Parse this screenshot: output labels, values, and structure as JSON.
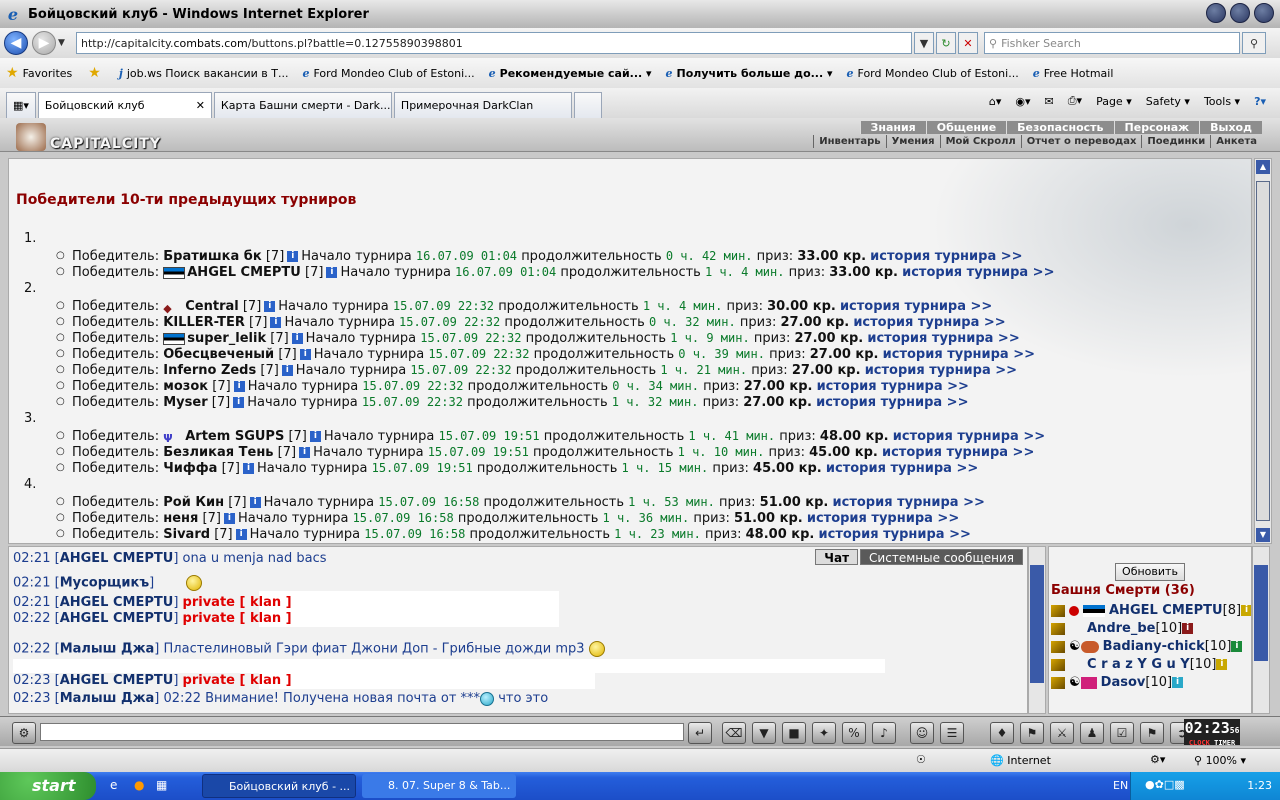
{
  "window": {
    "title": "Бойцовский клуб - Windows Internet Explorer"
  },
  "address": {
    "url_prefix": "http://capitalcity.",
    "url_host": "combats.com",
    "url_suffix": "/buttons.pl?battle=0.12755890398801",
    "search_placeholder": "Fishker Search"
  },
  "favorites": {
    "label": "Favorites",
    "links": [
      "job.ws Поиск вакансии в Т...",
      "Ford Mondeo Club of Estoni...",
      "Рекомендуемые сай...",
      "Получить больше до...",
      "Ford Mondeo Club of Estoni...",
      "Free Hotmail"
    ]
  },
  "tabs": [
    "Бойцовский клуб",
    "Карта Башни смерти - Dark...",
    "Примерочная DarkClan"
  ],
  "tab_tools": {
    "page": "Page",
    "safety": "Safety",
    "tools": "Tools"
  },
  "game": {
    "logo": "CAPITALCITY",
    "top_menu": [
      "Знания",
      "Общение",
      "Безопасность",
      "Персонаж",
      "Выход"
    ],
    "sub_menu": [
      "Инвентарь",
      "Умения",
      "Мой Скролл",
      "Отчет о переводах",
      "Поединки",
      "Анкета"
    ],
    "heading": "Победители 10-ти предыдущих турниров",
    "lbl_winner": "Победитель:",
    "lbl_start": "Начало турнира",
    "lbl_dur": "продолжительность",
    "lbl_prize": "приз:",
    "lbl_hist": "история турнира >>",
    "tournaments": [
      {
        "n": "1.",
        "winners": [
          {
            "name": "Братишка бк",
            "lvl": "[7]",
            "start": "16.07.09 01:04",
            "dur": "0 ч. 42 мин.",
            "prize": "33.00 кр."
          },
          {
            "name": "AHGEL CMEPTU",
            "lvl": "[7]",
            "start": "16.07.09 01:04",
            "dur": "1 ч. 4 мин.",
            "prize": "33.00 кр."
          }
        ]
      },
      {
        "n": "2.",
        "winners": [
          {
            "name": "Central",
            "lvl": "[7]",
            "start": "15.07.09 22:32",
            "dur": "1 ч. 4 мин.",
            "prize": "30.00 кр."
          },
          {
            "name": "KILLER-TER",
            "lvl": "[7]",
            "start": "15.07.09 22:32",
            "dur": "0 ч. 32 мин.",
            "prize": "27.00 кр."
          },
          {
            "name": "super_lelik",
            "lvl": "[7]",
            "start": "15.07.09 22:32",
            "dur": "1 ч. 9 мин.",
            "prize": "27.00 кр."
          },
          {
            "name": "Обесцвеченый",
            "lvl": "[7]",
            "start": "15.07.09 22:32",
            "dur": "0 ч. 39 мин.",
            "prize": "27.00 кр."
          },
          {
            "name": "Inferno Zeds",
            "lvl": "[7]",
            "start": "15.07.09 22:32",
            "dur": "1 ч. 21 мин.",
            "prize": "27.00 кр."
          },
          {
            "name": "мозок",
            "lvl": "[7]",
            "start": "15.07.09 22:32",
            "dur": "0 ч. 34 мин.",
            "prize": "27.00 кр."
          },
          {
            "name": "Myser",
            "lvl": "[7]",
            "start": "15.07.09 22:32",
            "dur": "1 ч. 32 мин.",
            "prize": "27.00 кр."
          }
        ]
      },
      {
        "n": "3.",
        "winners": [
          {
            "name": "Artem SGUPS",
            "lvl": "[7]",
            "start": "15.07.09 19:51",
            "dur": "1 ч. 41 мин.",
            "prize": "48.00 кр."
          },
          {
            "name": "Безликая Тень",
            "lvl": "[7]",
            "start": "15.07.09 19:51",
            "dur": "1 ч. 10 мин.",
            "prize": "45.00 кр."
          },
          {
            "name": "Чиффа",
            "lvl": "[7]",
            "start": "15.07.09 19:51",
            "dur": "1 ч. 15 мин.",
            "prize": "45.00 кр."
          }
        ]
      },
      {
        "n": "4.",
        "winners": [
          {
            "name": "Рой Кин",
            "lvl": "[7]",
            "start": "15.07.09 16:58",
            "dur": "1 ч. 53 мин.",
            "prize": "51.00 кр."
          },
          {
            "name": "неня",
            "lvl": "[7]",
            "start": "15.07.09 16:58",
            "dur": "1 ч. 36 мин.",
            "prize": "51.00 кр."
          },
          {
            "name": "Sivard",
            "lvl": "[7]",
            "start": "15.07.09 16:58",
            "dur": "1 ч. 23 мин.",
            "prize": "48.00 кр."
          }
        ]
      }
    ]
  },
  "chat": {
    "tabs": [
      "Чат",
      "Системные сообщения"
    ],
    "lines": [
      {
        "time": "02:21",
        "who": "AHGEL CMEPTU",
        "text": "ona u menja nad bacs",
        "priv": ""
      },
      {
        "time": "02:21",
        "who": "Мусорщикъ",
        "text": "",
        "priv": ""
      },
      {
        "time": "02:21",
        "who": "AHGEL CMEPTU",
        "text": "",
        "priv": "private [ klan ]"
      },
      {
        "time": "02:22",
        "who": "AHGEL CMEPTU",
        "text": "",
        "priv": "private [ klan ]"
      },
      {
        "time": "02:22",
        "who": "Малыш Джа",
        "text": "Пластелиновый Гэри фиат Джони Доп - Грибные дожди mp3",
        "priv": ""
      },
      {
        "time": "02:23",
        "who": "AHGEL CMEPTU",
        "text": "",
        "priv": "private [ klan ]"
      },
      {
        "time": "02:23",
        "who": "Малыш Джа",
        "text": "02:22 Внимание! Получена новая почта от ***",
        "priv": "",
        "tail": "что это"
      }
    ]
  },
  "online": {
    "refresh": "Обновить",
    "room": "Башня Смерти (36)",
    "users": [
      {
        "name": "AHGEL CMEPTU",
        "lvl": "[8]"
      },
      {
        "name": "Andre_be",
        "lvl": "[10]"
      },
      {
        "name": "Badiany-chick",
        "lvl": "[10]"
      },
      {
        "name": "C r a z Y G u Y",
        "lvl": "[10]"
      },
      {
        "name": "Dasov",
        "lvl": "[10]"
      }
    ]
  },
  "clock": {
    "time": "02:23",
    "sec": "56",
    "lbl_clock": "CLOCK",
    "lbl_timer": "TIMER"
  },
  "status": {
    "zone": "Internet",
    "zoom": "100%"
  },
  "taskbar": {
    "start": "start",
    "items": [
      "Бойцовский клуб - ...",
      "8. 07. Super 8 & Tab..."
    ],
    "lang": "EN",
    "time": "1:23"
  }
}
